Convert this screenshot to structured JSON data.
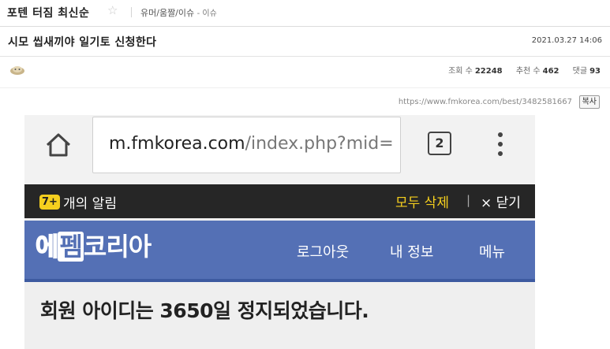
{
  "board": {
    "title": "포텐 터짐 최신순",
    "star_icon": "☆",
    "category": "유머/움짤/이슈",
    "subcategory": "- 이슈"
  },
  "post": {
    "title": "시모 씹새끼야 일기토 신청한다",
    "date": "2021.03.27 14:06",
    "stats": {
      "views_label": "조회 수",
      "views": "22248",
      "likes_label": "추천 수",
      "likes": "462",
      "comments_label": "댓글",
      "comments": "93"
    },
    "url": "https://www.fmkorea.com/best/3482581667",
    "copy_label": "복사"
  },
  "screenshot": {
    "url_main": "m.fmkorea.com",
    "url_rest": "/index.php?mid=",
    "tab_count": "2",
    "notif_badge": "7+",
    "notif_text": "개의 알림",
    "delete_all": "모두 삭제",
    "separator": "|",
    "close_label": "× 닫기",
    "logo": {
      "p1": "에",
      "p2": "펨",
      "p3": "코리아"
    },
    "nav": {
      "logout": "로그아웃",
      "myinfo": "내 정보",
      "menu": "메뉴"
    },
    "ban_message": "회원 아이디는 3650일 정지되었습니다."
  },
  "colors": {
    "nav_blue": "#5470b5",
    "badge_yellow": "#f5cf1e",
    "notif_bg": "#262626"
  }
}
